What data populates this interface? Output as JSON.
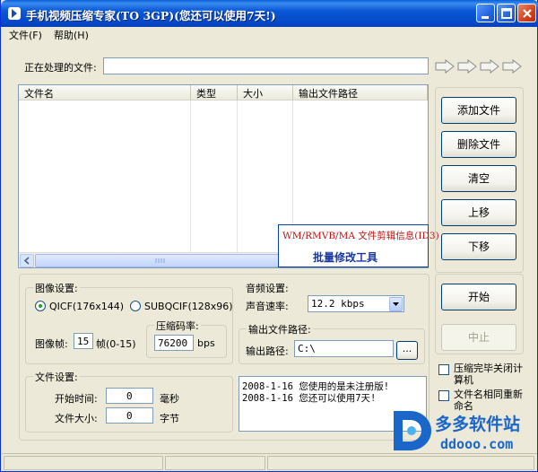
{
  "window": {
    "title": "手机视频压缩专家(TO 3GP)(您还可以使用7天!)"
  },
  "menu": {
    "items": [
      {
        "label": "文件(F)"
      },
      {
        "label": "帮助(H)"
      }
    ]
  },
  "processing": {
    "label": "正在处理的文件:",
    "value": ""
  },
  "file_list": {
    "columns": [
      "文件名",
      "类型",
      "大小",
      "输出文件路径"
    ],
    "rows": []
  },
  "overlay": {
    "line1": "WM/RMVB/MA 文件剪辑信息(ID3)",
    "line2": "批量修改工具"
  },
  "buttons": {
    "add_file": "添加文件",
    "delete_file": "删除文件",
    "clear": "清空",
    "move_up": "上移",
    "move_down": "下移",
    "start": "开始",
    "stop": "中止",
    "browse": "..."
  },
  "image_settings": {
    "title": "图像设置:",
    "qcif_label": "QICF(176x144)",
    "subqcif_label": "SUBQCIF(128x96)",
    "qcif_selected": true,
    "frame_label": "图像帧:",
    "frame_value": "15",
    "frame_range": "帧(0-15)",
    "bitrate_title": "压缩码率:",
    "bitrate_value": "76200",
    "bitrate_unit": "bps"
  },
  "audio_settings": {
    "title": "音频设置:",
    "rate_label": "声音速率:",
    "rate_value": "12.2 kbps"
  },
  "output_settings": {
    "title": "输出文件路径:",
    "path_label": "输出路径:",
    "path_value": "C:\\"
  },
  "file_settings": {
    "title": "文件设置:",
    "start_label": "开始时间:",
    "start_value": "0",
    "start_unit": "毫秒",
    "size_label": "文件大小:",
    "size_value": "0",
    "size_unit": "字节"
  },
  "options": {
    "shutdown_label": "压缩完毕关闭计算机",
    "overwrite_label": "文件名相同重新命名"
  },
  "log": {
    "lines": [
      "2008-1-16 您使用的是未注册版!",
      "2008-1-16 您还可以使用7天!"
    ]
  },
  "watermark": {
    "cn": "多多软件站",
    "en": "ddooo.com"
  },
  "colors": {
    "titlebar": "#0b58d5",
    "face": "#ece9d8",
    "overlay_red": "#c01010",
    "overlay_blue": "#1a37a0",
    "watermark_blue": "#1b66c9"
  }
}
